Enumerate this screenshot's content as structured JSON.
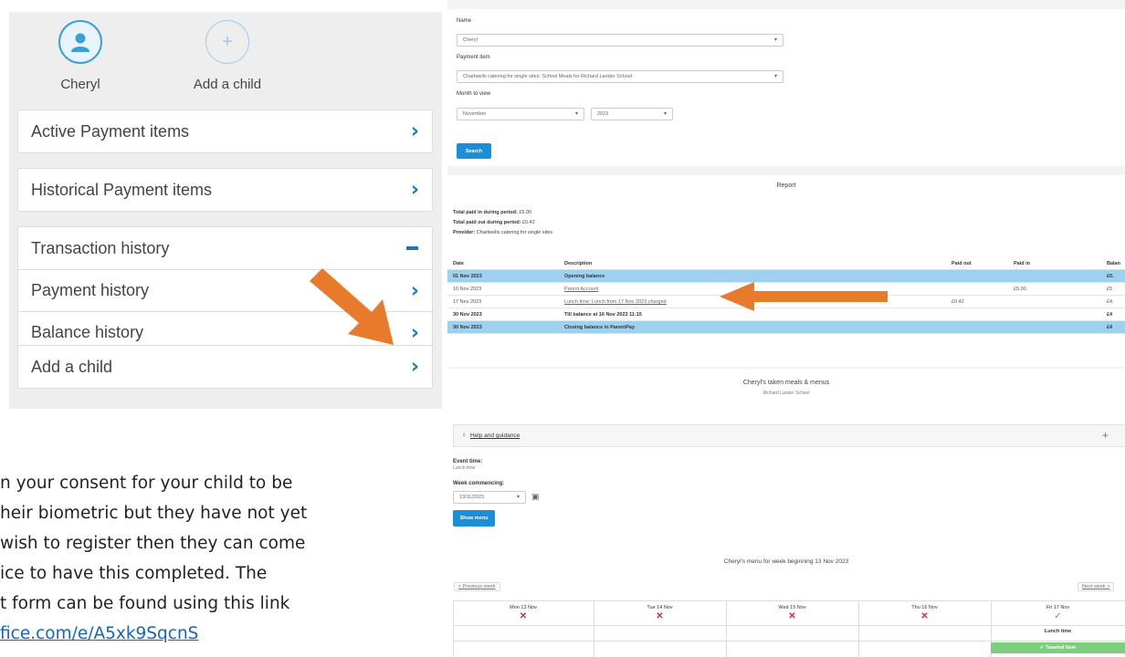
{
  "children": [
    {
      "name": "Cheryl",
      "icon": "person-icon"
    },
    {
      "name": "Add a child",
      "icon": "plus-circle-icon"
    }
  ],
  "menu": {
    "active_items": "Active Payment items",
    "historical_items": "Historical Payment items",
    "transaction_history": "Transaction history",
    "payment_history": "Payment history",
    "balance_history": "Balance history",
    "add_child": "Add a child"
  },
  "body_text": {
    "line1": "n your consent for your child to be",
    "line2": "heir biometric but they have not yet",
    "line3": "wish to register then they can come",
    "line4": "ice to have this completed. The",
    "line5": "t form can be found using this link",
    "link": "fice.com/e/A5xk9SqcnS"
  },
  "form": {
    "name_label": "Name",
    "name_value": "Cheryl",
    "payment_label": "Payment item",
    "payment_value": "Chartwells catering for single sites: School Meals for Richard Lander School",
    "month_label": "Month to view",
    "month_value": "November",
    "year_value": "2023",
    "search_button": "Search"
  },
  "report": {
    "title": "Report",
    "total_in_label": "Total paid in during period:",
    "total_in_value": "£5.00",
    "total_out_label": "Total paid out during period:",
    "total_out_value": "£0.42",
    "provider_label": "Provider:",
    "provider_value": "Chartwells catering for single sites",
    "headers": {
      "date": "Date",
      "description": "Description",
      "paid_out": "Paid out",
      "paid_in": "Paid in",
      "balance": "Balan"
    },
    "rows": [
      {
        "date": "01 Nov 2023",
        "description": "Opening balance",
        "paid_out": "",
        "paid_in": "",
        "balance": "£0."
      },
      {
        "date": "16 Nov 2023",
        "description": "Parent Account",
        "paid_out": "",
        "paid_in": "£5.00",
        "balance": "£5"
      },
      {
        "date": "17 Nov 2023",
        "description": "Lunch time: Lunch from 17 Nov 2023 charged",
        "paid_out": "£0.42",
        "paid_in": "",
        "balance": "£4."
      },
      {
        "date": "30 Nov 2023",
        "description": "Till balance at 16 Nov 2023 11:15",
        "paid_out": "",
        "paid_in": "",
        "balance": "£4"
      },
      {
        "date": "30 Nov 2023",
        "description": "Closing balance in ParentPay",
        "paid_out": "",
        "paid_in": "",
        "balance": "£4"
      }
    ]
  },
  "meals": {
    "title": "Cheryl's taken meals & menus",
    "school": "Richard Lander School",
    "help": "Help and guidance",
    "event_label": "Event time:",
    "event_value": "Lunch time",
    "week_label": "Week commencing:",
    "week_value": "13/11/2023",
    "show_button": "Show menu",
    "week_title": "Cheryl's menu for week beginning 13 Nov 2023",
    "prev": "< Previous week",
    "next": "Next week >",
    "days": [
      {
        "label": "Mon 13 Nov",
        "status": "none"
      },
      {
        "label": "Tue 14 Nov",
        "status": "none"
      },
      {
        "label": "Wed 15 Nov",
        "status": "none"
      },
      {
        "label": "Thu 16 Nov",
        "status": "none"
      },
      {
        "label": "Fri 17 Nov",
        "status": "taken"
      }
    ],
    "lunch_time": "Lunch time",
    "toasted_item": "✓ Toasted Item"
  },
  "colors": {
    "accent": "#1b75bc",
    "highlight": "#9ed1ee",
    "arrow": "#e87a2c",
    "button": "#1a8ed9"
  }
}
